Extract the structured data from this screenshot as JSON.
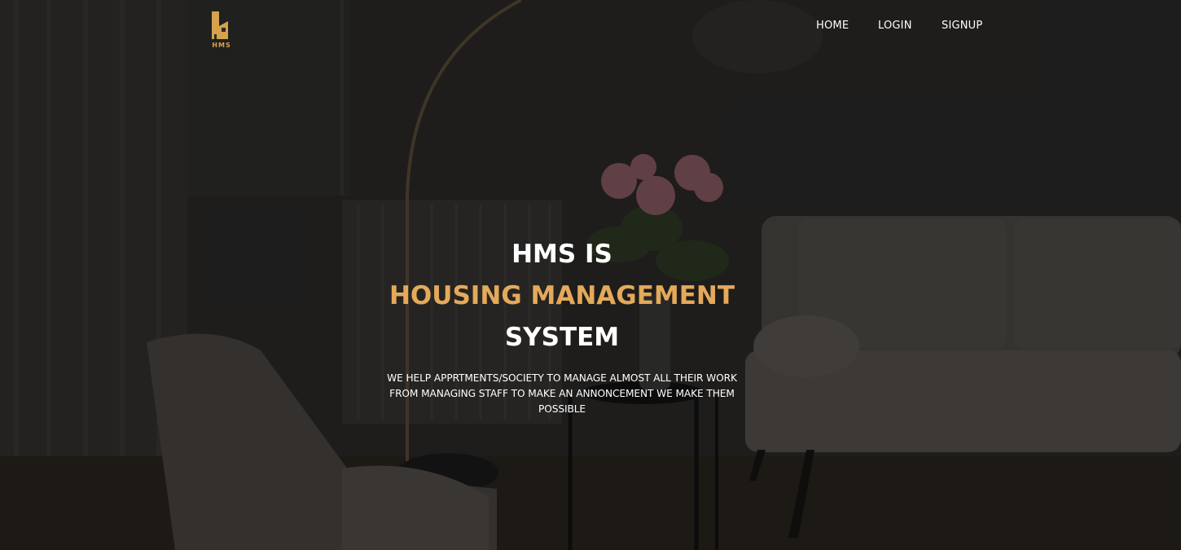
{
  "logo": {
    "text": "HMS",
    "accent_color": "#d7a24c"
  },
  "nav": {
    "home_label": "HOME",
    "login_label": "LOGIN",
    "signup_label": "SIGNUP"
  },
  "hero": {
    "line1": "HMS IS",
    "line2": "HOUSING MANAGEMENT",
    "line3": "SYSTEM",
    "tagline": "WE HELP APPRTMENTS/SOCIETY TO MANAGE ALMOST ALL THEIR WORK FROM MANAGING STAFF TO MAKE AN ANNONCEMENT WE MAKE THEM POSSIBLE"
  },
  "colors": {
    "accent": "#e4a95a",
    "text": "#ffffff",
    "overlay": "#1f1e1d"
  }
}
